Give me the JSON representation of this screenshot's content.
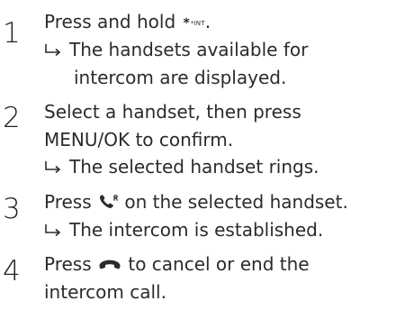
{
  "steps": [
    {
      "number": "1",
      "line1_before": "Press and hold ",
      "line1_key": "*INT",
      "line1_after": ".",
      "result_line1": "The handsets available for",
      "result_line2": "intercom are displayed."
    },
    {
      "number": "2",
      "line1": "Select a handset, then press",
      "line2": "MENU/OK to confirm.",
      "result_line1": "The selected handset rings."
    },
    {
      "number": "3",
      "line1_before": "Press ",
      "line1_icon": "talk-phone-icon",
      "line1_after": " on the selected handset.",
      "result_line1": "The intercom is established."
    },
    {
      "number": "4",
      "line1_before": "Press ",
      "line1_icon": "end-call-icon",
      "line1_after": " to cancel or end the",
      "line2": "intercom call."
    }
  ],
  "icons": {
    "result_arrow": "result-arrow-icon"
  },
  "colors": {
    "text": "#2b2b2b",
    "background": "#ffffff"
  }
}
